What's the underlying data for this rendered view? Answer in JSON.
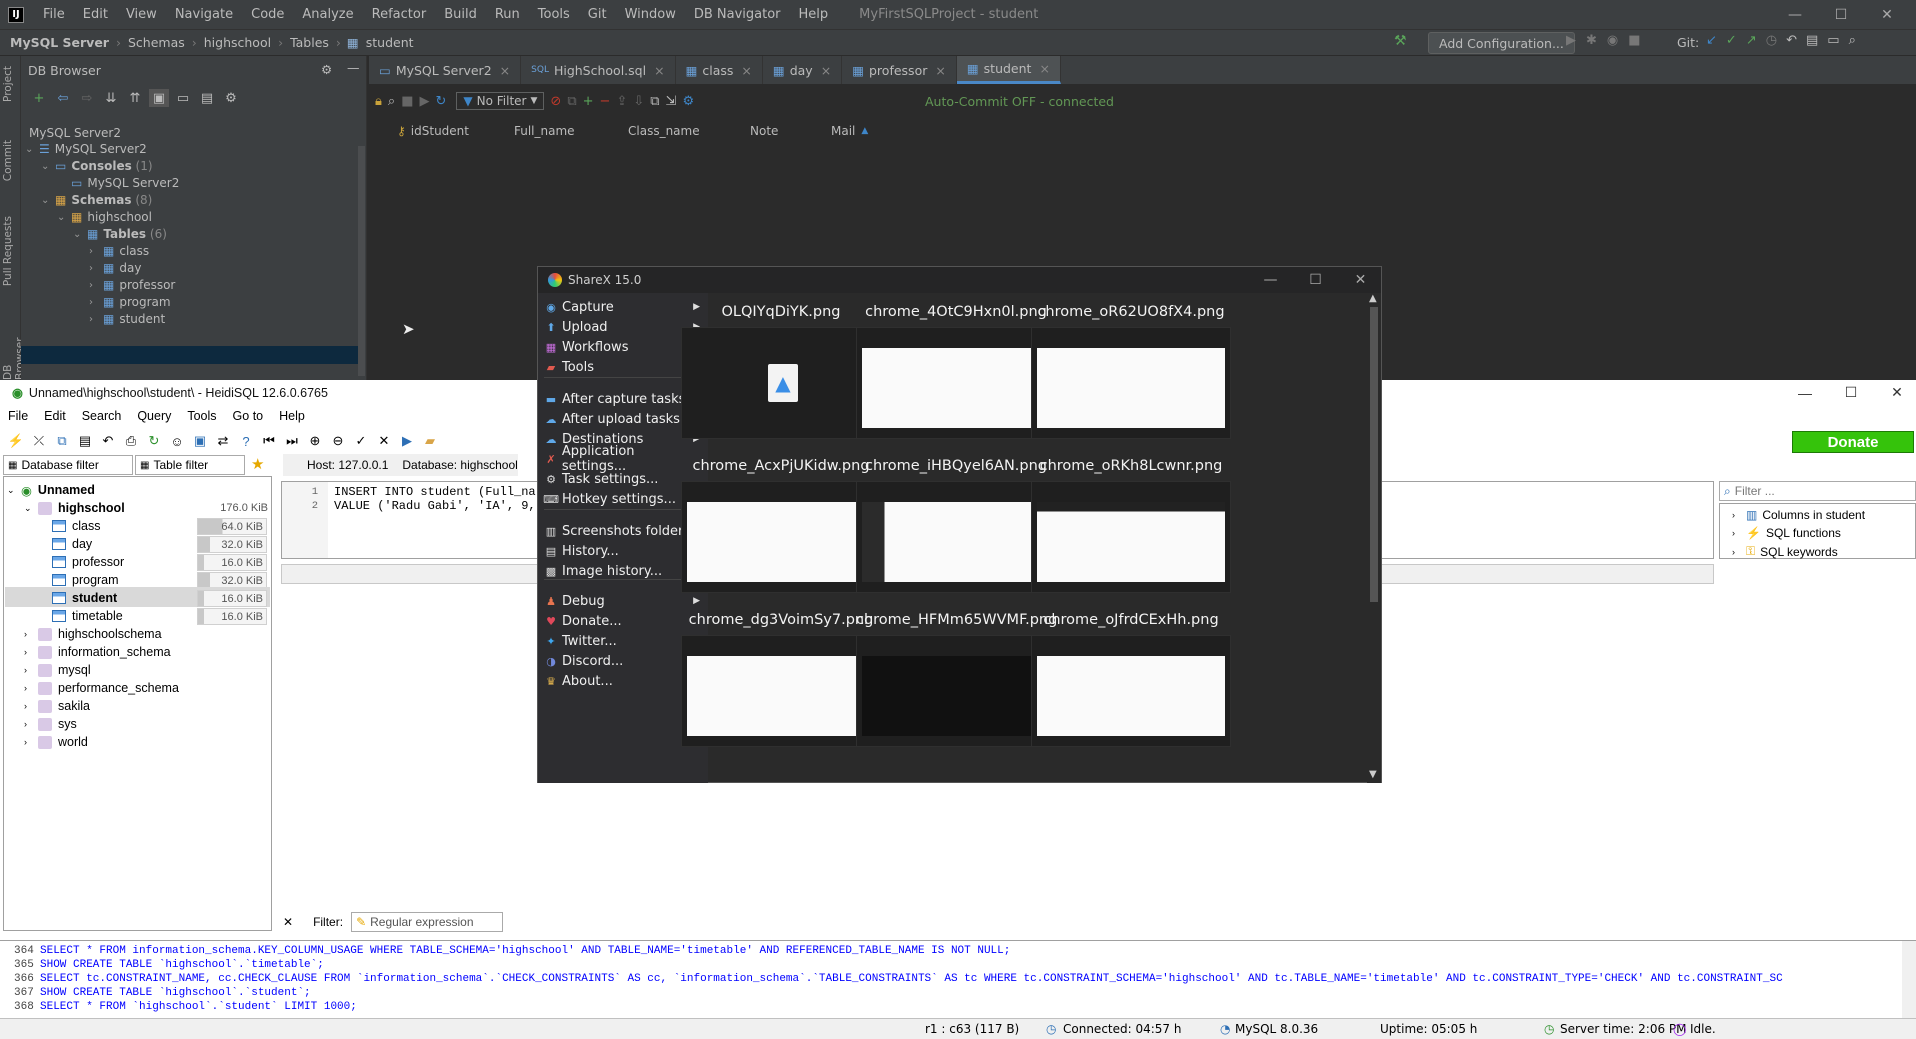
{
  "ide": {
    "menu": [
      "File",
      "Edit",
      "View",
      "Navigate",
      "Code",
      "Analyze",
      "Refactor",
      "Build",
      "Run",
      "Tools",
      "Git",
      "Window",
      "DB Navigator",
      "Help"
    ],
    "project_title": "MyFirstSQLProject - student",
    "breadcrumbs": [
      "MySQL Server",
      "Schemas",
      "highschool",
      "Tables",
      "student"
    ],
    "add_configuration": "Add Configuration...",
    "git_label": "Git:",
    "side_tabs": [
      "Project",
      "Commit",
      "Pull Requests",
      "DB Browser"
    ],
    "db_browser": {
      "title": "DB Browser",
      "connection_label": "MySQL Server2",
      "tree": {
        "root": "MySQL Server2",
        "consoles": "Consoles",
        "consoles_count": "(1)",
        "console_item": "MySQL Server2",
        "schemas": "Schemas",
        "schemas_count": "(8)",
        "schema": "highschool",
        "tables": "Tables",
        "tables_count": "(6)",
        "table_items": [
          "class",
          "day",
          "professor",
          "program",
          "student",
          "timetable"
        ]
      }
    },
    "tabs": [
      "MySQL Server2",
      "HighSchool.sql",
      "class",
      "day",
      "professor",
      "student"
    ],
    "filter": "No Filter",
    "autocommit": "Auto-Commit OFF - connected",
    "columns": [
      "idStudent",
      "Full_name",
      "Class_name",
      "Note",
      "Mail"
    ]
  },
  "heidi": {
    "title": "Unnamed\\highschool\\student\\ - HeidiSQL 12.6.0.6765",
    "menu": [
      "File",
      "Edit",
      "Search",
      "Query",
      "Tools",
      "Go to",
      "Help"
    ],
    "donate": "Donate",
    "db_filter": "Database filter",
    "table_filter": "Table filter",
    "host": "Host: 127.0.0.1",
    "database": "Database: highschool",
    "tree": {
      "root": "Unnamed",
      "db": "highschool",
      "db_size": "176.0 KiB",
      "tables": [
        {
          "name": "class",
          "size": "64.0 KiB",
          "fill": 0.36
        },
        {
          "name": "day",
          "size": "32.0 KiB",
          "fill": 0.18
        },
        {
          "name": "professor",
          "size": "16.0 KiB",
          "fill": 0.09
        },
        {
          "name": "program",
          "size": "32.0 KiB",
          "fill": 0.18
        },
        {
          "name": "student",
          "size": "16.0 KiB",
          "fill": 0.09
        },
        {
          "name": "timetable",
          "size": "16.0 KiB",
          "fill": 0.09
        }
      ],
      "other_dbs": [
        "highschoolschema",
        "information_schema",
        "mysql",
        "performance_schema",
        "sakila",
        "sys",
        "world"
      ]
    },
    "editor": {
      "line1": "INSERT INTO student (Full_na",
      "line2": "VALUE ('Radu Gabi', 'IA', 9,"
    },
    "filter_placeholder": "Filter ...",
    "helpers": [
      "Columns in student",
      "SQL functions",
      "SQL keywords"
    ],
    "filter_label": "Filter:",
    "regex_placeholder": "Regular expression",
    "log": [
      {
        "n": "364",
        "text": "SELECT * FROM information_schema.KEY_COLUMN_USAGE WHERE   TABLE_SCHEMA='highschool'   AND TABLE_NAME='timetable'   AND REFERENCED_TABLE_NAME IS NOT NULL;"
      },
      {
        "n": "365",
        "text": "SHOW CREATE TABLE `highschool`.`timetable`;"
      },
      {
        "n": "366",
        "text": "SELECT tc.CONSTRAINT_NAME, cc.CHECK_CLAUSE FROM `information_schema`.`CHECK_CONSTRAINTS` AS cc, `information_schema`.`TABLE_CONSTRAINTS` AS tc WHERE tc.CONSTRAINT_SCHEMA='highschool' AND tc.TABLE_NAME='timetable' AND tc.CONSTRAINT_TYPE='CHECK' AND tc.CONSTRAINT_SC"
      },
      {
        "n": "367",
        "text": "SHOW CREATE TABLE `highschool`.`student`;"
      },
      {
        "n": "368",
        "text": "SELECT * FROM `highschool`.`student` LIMIT 1000;"
      }
    ],
    "status": {
      "pos": "r1 : c63 (117 B)",
      "connected": "Connected: 04:57 h",
      "version": "MySQL 8.0.36",
      "uptime": "Uptime: 05:05 h",
      "server_time": "Server time: 2:06 PM",
      "idle": "Idle."
    }
  },
  "sharex": {
    "title": "ShareX 15.0",
    "menu": [
      {
        "label": "Capture",
        "sub": true,
        "icon": "camera-icon"
      },
      {
        "label": "Upload",
        "sub": true,
        "icon": "upload-icon"
      },
      {
        "label": "Workflows",
        "sub": true,
        "icon": "workflows-icon"
      },
      {
        "label": "Tools",
        "sub": true,
        "icon": "toolbox-icon"
      },
      {
        "label": "After capture tasks",
        "sub": true,
        "icon": "after-capture-icon"
      },
      {
        "label": "After upload tasks",
        "sub": true,
        "icon": "after-upload-icon"
      },
      {
        "label": "Destinations",
        "sub": true,
        "icon": "destinations-icon"
      },
      {
        "label": "Application settings...",
        "sub": false,
        "icon": "tools-icon"
      },
      {
        "label": "Task settings...",
        "sub": false,
        "icon": "gear-icon"
      },
      {
        "label": "Hotkey settings...",
        "sub": false,
        "icon": "keyboard-icon"
      },
      {
        "label": "Screenshots folder...",
        "sub": false,
        "icon": "folder-icon"
      },
      {
        "label": "History...",
        "sub": false,
        "icon": "history-icon"
      },
      {
        "label": "Image history...",
        "sub": false,
        "icon": "image-history-icon"
      },
      {
        "label": "Debug",
        "sub": true,
        "icon": "debug-icon"
      },
      {
        "label": "Donate...",
        "sub": false,
        "icon": "heart-icon"
      },
      {
        "label": "Twitter...",
        "sub": false,
        "icon": "twitter-icon"
      },
      {
        "label": "Discord...",
        "sub": false,
        "icon": "discord-icon"
      },
      {
        "label": "About...",
        "sub": false,
        "icon": "crown-icon"
      }
    ],
    "thumbs": [
      "OLQIYqDiYK.png",
      "chrome_4OtC9Hxn0l.png",
      "chrome_oR62UO8fX4.png",
      "chrome_AcxPjUKidw.png",
      "chrome_iHBQyel6AN.png",
      "chrome_oRKh8Lcwnr.png",
      "chrome_dg3VoimSy7.png",
      "chrome_HFMm65WVMF.png",
      "chrome_oJfrdCExHh.png"
    ]
  },
  "colors": {
    "ide_bg": "#2b2b2b",
    "ide_panel": "#3c3f41",
    "accent": "#4a88c7",
    "donate": "#35c30b",
    "autocommit": "#629755"
  }
}
